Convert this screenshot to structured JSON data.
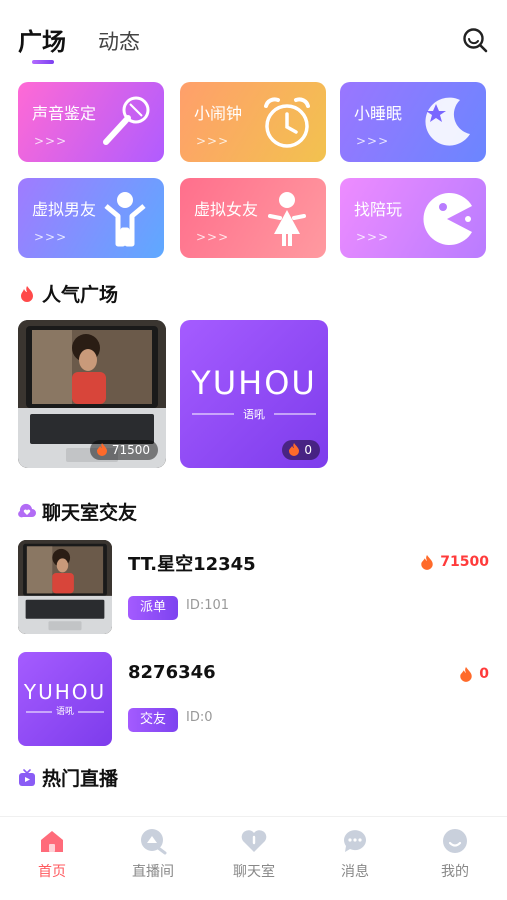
{
  "header": {
    "tabs": [
      {
        "label": "广场",
        "active": true
      },
      {
        "label": "动态",
        "active": false
      }
    ]
  },
  "categories": [
    {
      "label": "声音鉴定",
      "arrows": ">>>",
      "icon": "microphone-icon"
    },
    {
      "label": "小闹钟",
      "arrows": ">>>",
      "icon": "alarm-clock-icon"
    },
    {
      "label": "小睡眠",
      "arrows": ">>>",
      "icon": "moon-star-icon"
    },
    {
      "label": "虚拟男友",
      "arrows": ">>>",
      "icon": "boy-icon"
    },
    {
      "label": "虚拟女友",
      "arrows": ">>>",
      "icon": "girl-icon"
    },
    {
      "label": "找陪玩",
      "arrows": ">>>",
      "icon": "pacman-icon"
    }
  ],
  "sections": {
    "popular": "人气广场",
    "chat": "聊天室交友",
    "live": "热门直播"
  },
  "popular_tiles": [
    {
      "heat": "71500"
    },
    {
      "heat": "0",
      "brand": "YUHOU",
      "brand_sub": "语吼"
    }
  ],
  "chat_rooms": [
    {
      "name": "TT.星空12345",
      "tag": "派单",
      "id_text": "ID:101",
      "heat": "71500"
    },
    {
      "name": "8276346",
      "tag": "交友",
      "id_text": "ID:0",
      "heat": "0",
      "brand": "YUHOU",
      "brand_sub": "语吼"
    }
  ],
  "bottom_nav": [
    {
      "label": "首页",
      "active": true
    },
    {
      "label": "直播间",
      "active": false
    },
    {
      "label": "聊天室",
      "active": false
    },
    {
      "label": "消息",
      "active": false
    },
    {
      "label": "我的",
      "active": false
    }
  ],
  "colors": {
    "accent_purple": "#8a4cf5",
    "hot_red": "#ff3b3b",
    "nav_active": "#ff5a5f"
  }
}
